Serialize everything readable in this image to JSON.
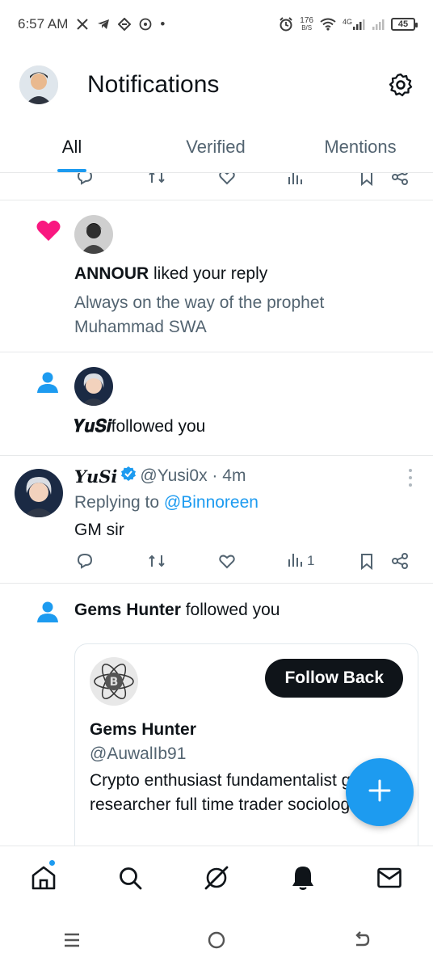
{
  "status_bar": {
    "time": "6:57 AM",
    "dot": "•",
    "speed_value": "176",
    "speed_unit": "B/S",
    "network": "4G",
    "battery": "45"
  },
  "header": {
    "title": "Notifications"
  },
  "tabs": [
    {
      "label": "All",
      "active": true
    },
    {
      "label": "Verified",
      "active": false
    },
    {
      "label": "Mentions",
      "active": false
    }
  ],
  "notifications": {
    "like": {
      "user": "ANNOUR",
      "action": " liked your reply",
      "snippet": "Always on the way of the prophet Muhammad SWA"
    },
    "follow_yusi": {
      "user": "𝒀𝒖𝑺𝒊",
      "action": "followed you"
    },
    "tweet": {
      "name": "𝒀𝒖𝑺𝒊",
      "handle": "@Yusi0x · 4m",
      "replying_prefix": "Replying to ",
      "replying_to": "@Binnoreen",
      "body": "GM sir",
      "views": "1"
    },
    "follow_gems": {
      "user": "Gems Hunter",
      "action": " followed you",
      "card": {
        "name": "Gems Hunter",
        "handle": "@AuwalIb91",
        "bio": "Crypto enthusiast fundamentalist gems researcher  full time trader sociologist",
        "follow_label": "Follow Back"
      }
    }
  },
  "colors": {
    "accent": "#1d9bf0",
    "like": "#f91880",
    "text": "#0f1419",
    "muted": "#536471"
  }
}
